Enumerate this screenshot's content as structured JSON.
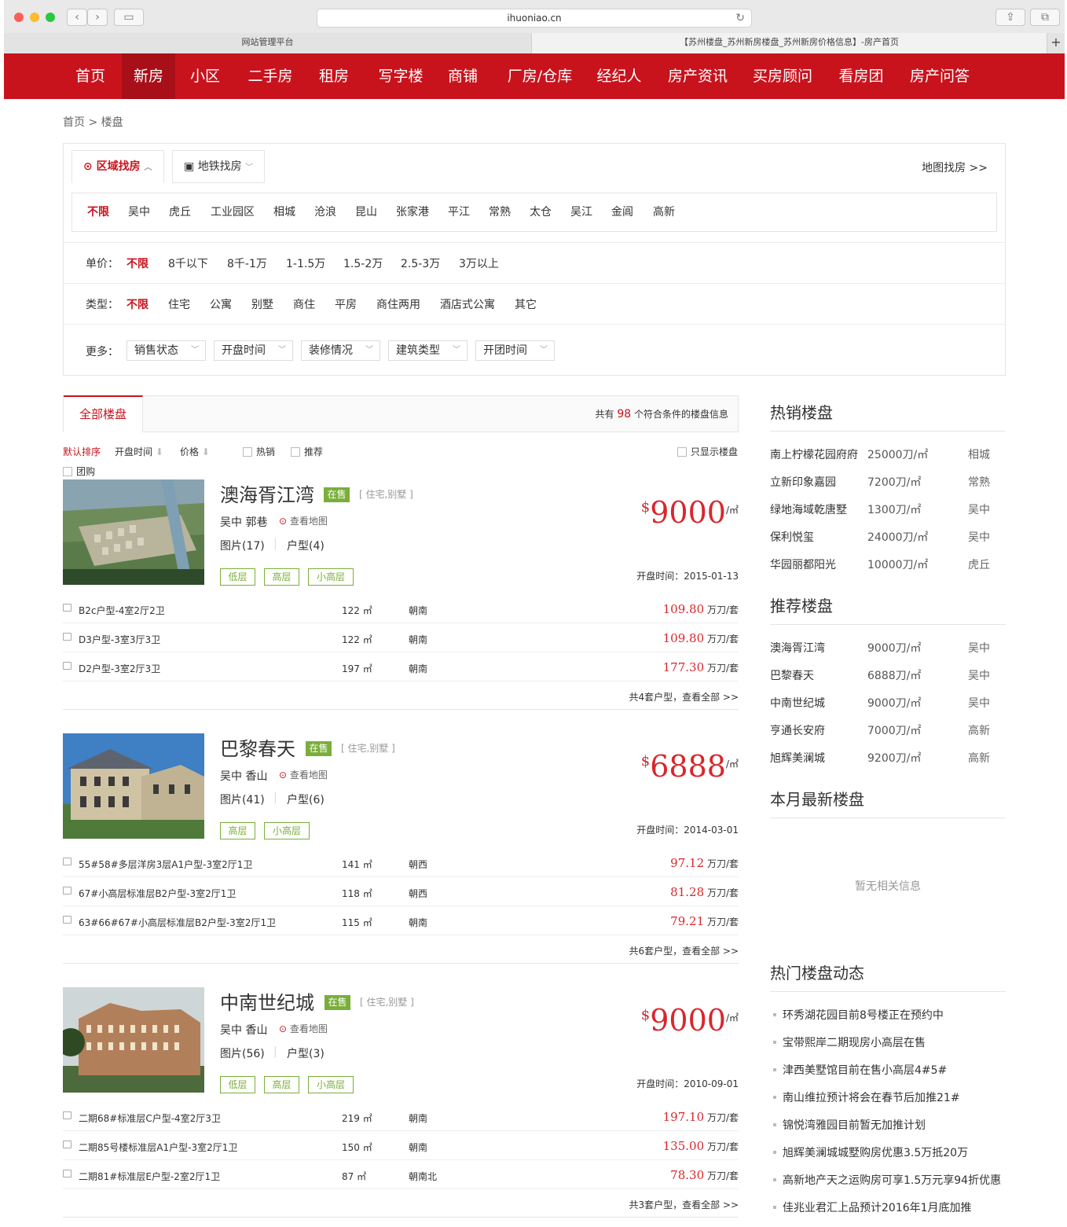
{
  "browser": {
    "url": "ihuoniao.cn",
    "tabs": [
      "网站管理平台",
      "【苏州楼盘_苏州新房楼盘_苏州新房价格信息】-房产首页"
    ],
    "add_tab": "+"
  },
  "nav": {
    "items": [
      "首页",
      "新房",
      "小区",
      "二手房",
      "租房",
      "写字楼",
      "商铺",
      "厂房/仓库",
      "经纪人",
      "房产资讯",
      "买房顾问",
      "看房团",
      "房产问答"
    ],
    "active_index": 1
  },
  "breadcrumb": "首页 > 楼盘",
  "search": {
    "region_tab": "区域找房",
    "subway_tab": "地铁找房",
    "map_link": "地图找房 >>",
    "regions": [
      "不限",
      "吴中",
      "虎丘",
      "工业园区",
      "相城",
      "沧浪",
      "昆山",
      "张家港",
      "平江",
      "常熟",
      "太仓",
      "吴江",
      "金阊",
      "高新"
    ],
    "price_label": "单价：",
    "prices": [
      "不限",
      "8千以下",
      "8千-1万",
      "1-1.5万",
      "1.5-2万",
      "2.5-3万",
      "3万以上"
    ],
    "type_label": "类型：",
    "types": [
      "不限",
      "住宅",
      "公寓",
      "别墅",
      "商住",
      "平房",
      "商住两用",
      "酒店式公寓",
      "其它"
    ],
    "more_label": "更多：",
    "dropdowns": [
      "销售状态",
      "开盘时间",
      "装修情况",
      "建筑类型",
      "开团时间"
    ]
  },
  "listing_header": {
    "tab": "全部楼盘",
    "count_prefix": "共有",
    "count": "98",
    "count_suffix": "个符合条件的楼盘信息"
  },
  "sort": {
    "default": "默认排序",
    "open_time": "开盘时间",
    "price": "价格",
    "hot": "热销",
    "recommended": "推荐",
    "group": "团购",
    "only_show": "只显示楼盘"
  },
  "listings": [
    {
      "name": "澳海胥江湾",
      "status": "在售",
      "types": "[ 住宅,别墅 ]",
      "location": "吴中 郭巷",
      "map_link": "查看地图",
      "photos": "图片(17)",
      "layouts": "户型(4)",
      "tags": [
        "低层",
        "高层",
        "小高层"
      ],
      "price_currency": "$",
      "price": "9000",
      "price_unit": "/㎡",
      "open_date": "开盘时间：2015-01-13",
      "units": [
        {
          "name": "B2c户型-4室2厅2卫",
          "area": "122 ㎡",
          "direction": "朝南",
          "price": "109.80",
          "unit": "万刀/套"
        },
        {
          "name": "D3户型-3室3厅3卫",
          "area": "122 ㎡",
          "direction": "朝南",
          "price": "109.80",
          "unit": "万刀/套"
        },
        {
          "name": "D2户型-3室2厅3卫",
          "area": "197 ㎡",
          "direction": "朝南",
          "price": "177.30",
          "unit": "万刀/套"
        }
      ],
      "view_all": "共4套户型，查看全部 >>"
    },
    {
      "name": "巴黎春天",
      "status": "在售",
      "types": "[ 住宅,别墅 ]",
      "location": "吴中 香山",
      "map_link": "查看地图",
      "photos": "图片(41)",
      "layouts": "户型(6)",
      "tags": [
        "高层",
        "小高层"
      ],
      "price_currency": "$",
      "price": "6888",
      "price_unit": "/㎡",
      "open_date": "开盘时间：2014-03-01",
      "units": [
        {
          "name": "55#58#多层洋房3层A1户型-3室2厅1卫",
          "area": "141 ㎡",
          "direction": "朝西",
          "price": "97.12",
          "unit": "万刀/套"
        },
        {
          "name": "67#小高层标准层B2户型-3室2厅1卫",
          "area": "118 ㎡",
          "direction": "朝西",
          "price": "81.28",
          "unit": "万刀/套"
        },
        {
          "name": "63#66#67#小高层标准层B2户型-3室2厅1卫",
          "area": "115 ㎡",
          "direction": "朝南",
          "price": "79.21",
          "unit": "万刀/套"
        }
      ],
      "view_all": "共6套户型，查看全部 >>"
    },
    {
      "name": "中南世纪城",
      "status": "在售",
      "types": "[ 住宅,别墅 ]",
      "location": "吴中 香山",
      "map_link": "查看地图",
      "photos": "图片(56)",
      "layouts": "户型(3)",
      "tags": [
        "低层",
        "高层",
        "小高层"
      ],
      "price_currency": "$",
      "price": "9000",
      "price_unit": "/㎡",
      "open_date": "开盘时间：2010-09-01",
      "units": [
        {
          "name": "二期68#标准层C户型-4室2厅3卫",
          "area": "219 ㎡",
          "direction": "朝南",
          "price": "197.10",
          "unit": "万刀/套"
        },
        {
          "name": "二期85号楼标准层A1户型-3室2厅1卫",
          "area": "150 ㎡",
          "direction": "朝南",
          "price": "135.00",
          "unit": "万刀/套"
        },
        {
          "name": "二期81#标准层E户型-2室2厅1卫",
          "area": "87 ㎡",
          "direction": "朝南北",
          "price": "78.30",
          "unit": "万刀/套"
        }
      ],
      "view_all": "共3套户型，查看全部 >>"
    }
  ],
  "sidebar": {
    "hot_title": "热销楼盘",
    "hot": [
      {
        "name": "南上柠檬花园府府",
        "price": "25000刀/㎡",
        "region": "相城"
      },
      {
        "name": "立新印象嘉园",
        "price": "7200刀/㎡",
        "region": "常熟"
      },
      {
        "name": "绿地海域乾唐墅",
        "price": "1300刀/㎡",
        "region": "吴中"
      },
      {
        "name": "保利悦玺",
        "price": "24000刀/㎡",
        "region": "吴中"
      },
      {
        "name": "华园丽都阳光",
        "price": "10000刀/㎡",
        "region": "虎丘"
      }
    ],
    "rec_title": "推荐楼盘",
    "rec": [
      {
        "name": "澳海胥江湾",
        "price": "9000刀/㎡",
        "region": "吴中"
      },
      {
        "name": "巴黎春天",
        "price": "6888刀/㎡",
        "region": "吴中"
      },
      {
        "name": "中南世纪城",
        "price": "9000刀/㎡",
        "region": "吴中"
      },
      {
        "name": "亨通长安府",
        "price": "7000刀/㎡",
        "region": "高新"
      },
      {
        "name": "旭辉美澜城",
        "price": "9200刀/㎡",
        "region": "高新"
      }
    ],
    "new_title": "本月最新楼盘",
    "new_empty": "暂无相关信息",
    "news_title": "热门楼盘动态",
    "news": [
      "环秀湖花园目前8号楼正在预约中",
      "宝带熙岸二期现房小高层在售",
      "津西美墅馆目前在售小高层4#5#",
      "南山维拉预计将会在春节后加推21#",
      "锦悦湾雅园目前暂无加推计划",
      "旭辉美澜城城墅购房优惠3.5万抵20万",
      "高新地产天之运购房可享1.5万元享94折优惠",
      "佳兆业君汇上品预计2016年1月底加推"
    ]
  }
}
